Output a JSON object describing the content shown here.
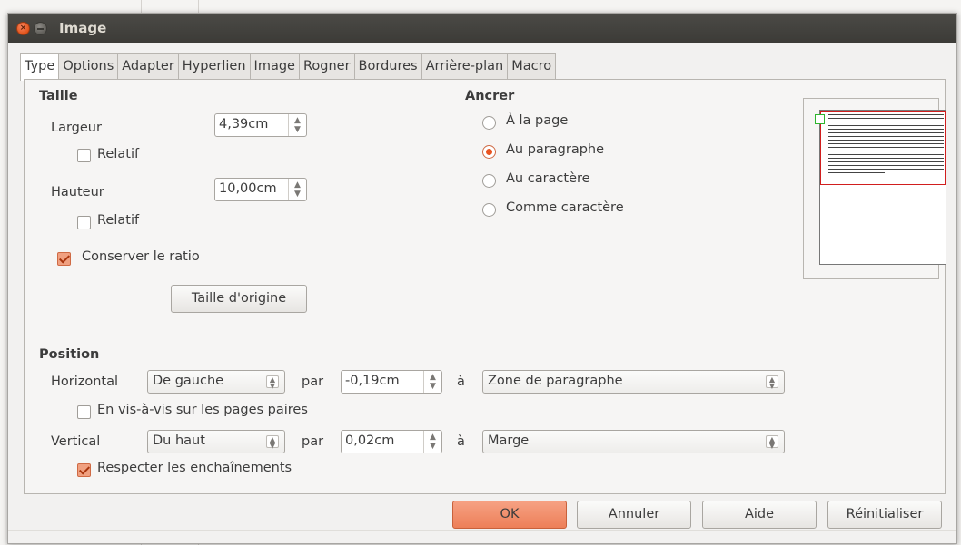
{
  "window": {
    "title": "Image"
  },
  "tabs": [
    "Type",
    "Options",
    "Adapter",
    "Hyperlien",
    "Image",
    "Rogner",
    "Bordures",
    "Arrière-plan",
    "Macro"
  ],
  "taille": {
    "heading": "Taille",
    "largeur_label": "Largeur",
    "largeur_value": "4,39cm",
    "relatif1_label": "Relatif",
    "hauteur_label": "Hauteur",
    "hauteur_value": "10,00cm",
    "relatif2_label": "Relatif",
    "ratio_label": "Conserver le ratio",
    "ratio_checked": true,
    "origine_button": "Taille d'origine"
  },
  "ancrer": {
    "heading": "Ancrer",
    "options": [
      "À la page",
      "Au paragraphe",
      "Au caractère",
      "Comme caractère"
    ],
    "selected": "Au paragraphe"
  },
  "position": {
    "heading": "Position",
    "horizontal_label": "Horizontal",
    "horizontal_select": "De gauche",
    "par1": "par",
    "horizontal_value": "-0,19cm",
    "a1": "à",
    "horizontal_zone": "Zone de paragraphe",
    "visavis_label": "En vis-à-vis sur les pages paires",
    "vertical_label": "Vertical",
    "vertical_select": "Du haut",
    "par2": "par",
    "vertical_value": "0,02cm",
    "a2": "à",
    "vertical_zone": "Marge",
    "respect_label": "Respecter les enchaînements",
    "respect_checked": true
  },
  "buttons": {
    "ok": "OK",
    "cancel": "Annuler",
    "help": "Aide",
    "reset": "Réinitialiser"
  },
  "colors": {
    "accent": "#e95420",
    "titlebar": "#3c3b37"
  }
}
